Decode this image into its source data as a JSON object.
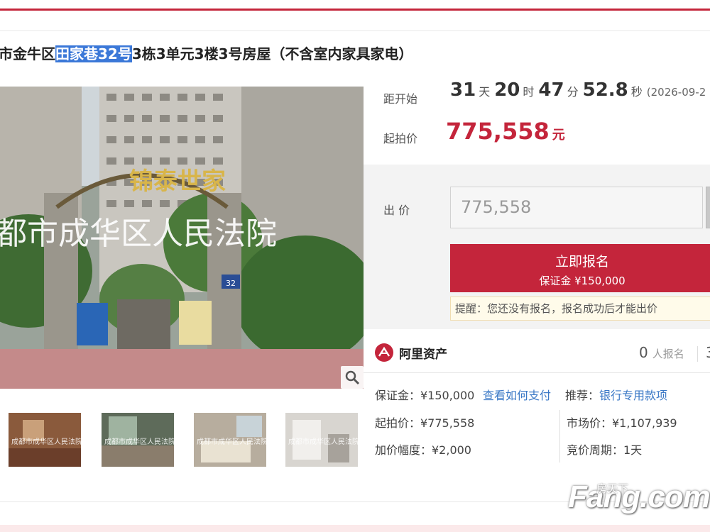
{
  "listing": {
    "title_prefix": "市金牛区",
    "title_highlight": "田家巷32号",
    "title_suffix": "3栋3单元3楼3号房屋（不含室内家具家电）"
  },
  "photo": {
    "gate_sign": "锦泰世家",
    "court_watermark": "都市成华区人民法院",
    "house_number": "32"
  },
  "countdown": {
    "label": "距开始",
    "days": "31",
    "days_unit": "天",
    "hours": "20",
    "hours_unit": "时",
    "minutes": "47",
    "minutes_unit": "分",
    "seconds": "52.8",
    "seconds_unit": "秒",
    "date": "(2026-09-2"
  },
  "start_price": {
    "label": "起拍价",
    "value": "775,558",
    "currency": "元"
  },
  "bid": {
    "label": "出 价",
    "input_value": "775,558",
    "button_title": "立即报名",
    "button_deposit": "保证金 ¥150,000",
    "tip": "提醒：您还没有报名，报名成功后才能出价"
  },
  "org": {
    "name": "阿里资产",
    "enroll_count": "0",
    "enroll_text": "人报名",
    "next_count": "3"
  },
  "details": {
    "deposit": "保证金：¥150,000",
    "pay_link": "查看如何支付",
    "recommend_label": "推荐：",
    "recommend_link": "银行专用款项",
    "start_price": "起拍价：¥775,558",
    "market_price": "市场价：¥1,107,939",
    "increment": "加价幅度：¥2,000",
    "cycle": "竞价周期：1天"
  },
  "thumb_watermark": "成都市成华区人民法院",
  "site_watermark": {
    "brand": "Fang.com",
    "cn": "房天下"
  },
  "colors": {
    "accent": "#c4253b",
    "link": "#3a78c6",
    "highlight": "#3b78d8"
  }
}
